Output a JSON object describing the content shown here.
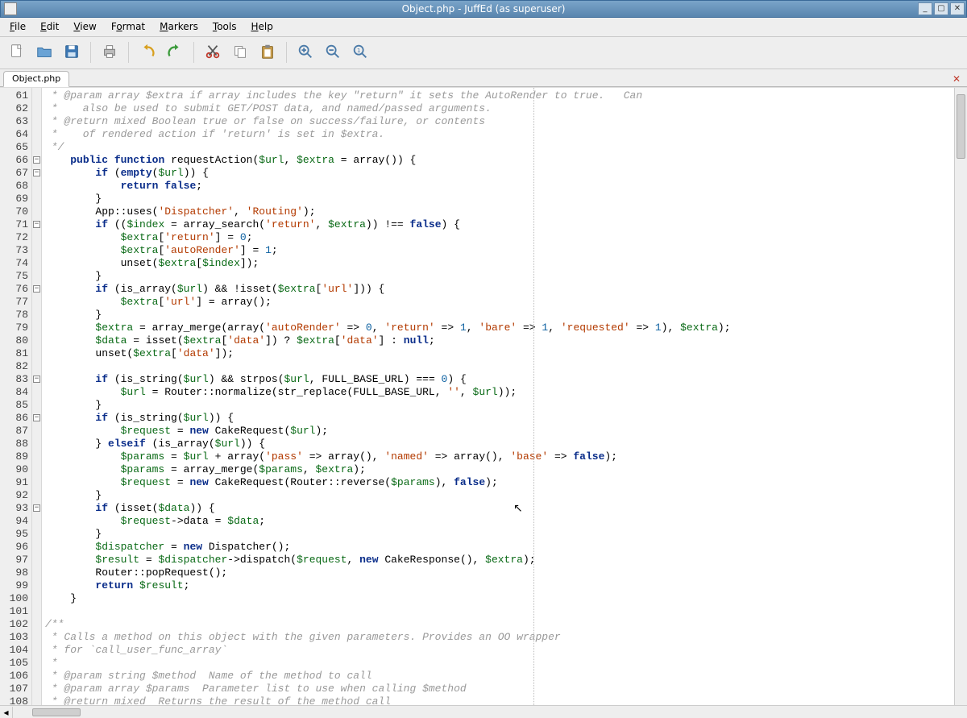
{
  "window": {
    "title": "Object.php - JuffEd (as superuser)"
  },
  "menubar": {
    "items": [
      {
        "label": "File",
        "accel": "F"
      },
      {
        "label": "Edit",
        "accel": "E"
      },
      {
        "label": "View",
        "accel": "V"
      },
      {
        "label": "Format",
        "accel": "o"
      },
      {
        "label": "Markers",
        "accel": "M"
      },
      {
        "label": "Tools",
        "accel": "T"
      },
      {
        "label": "Help",
        "accel": "H"
      }
    ]
  },
  "toolbar": {
    "buttons": [
      "new-file",
      "open-file",
      "save-file",
      "sep",
      "print",
      "sep",
      "undo",
      "redo",
      "sep",
      "cut",
      "copy",
      "paste",
      "sep",
      "zoom-in",
      "zoom-out",
      "zoom-reset"
    ]
  },
  "tabs": {
    "items": [
      {
        "label": "Object.php"
      }
    ]
  },
  "editor": {
    "first_line": 61,
    "fold_lines": [
      66,
      67,
      71,
      76,
      83,
      86,
      93
    ],
    "lines": [
      {
        "n": 61,
        "seg": [
          {
            "c": "c-comment",
            "t": " * @param array $extra if array includes the key \"return\" it sets the AutoRender to true.   Can"
          }
        ]
      },
      {
        "n": 62,
        "seg": [
          {
            "c": "c-comment",
            "t": " *    also be used to submit GET/POST data, and named/passed arguments."
          }
        ]
      },
      {
        "n": 63,
        "seg": [
          {
            "c": "c-comment",
            "t": " * @return mixed Boolean true or false on success/failure, or contents"
          }
        ]
      },
      {
        "n": 64,
        "seg": [
          {
            "c": "c-comment",
            "t": " *    of rendered action if 'return' is set in $extra."
          }
        ]
      },
      {
        "n": 65,
        "seg": [
          {
            "c": "c-comment",
            "t": " */"
          }
        ]
      },
      {
        "n": 66,
        "seg": [
          {
            "t": "    "
          },
          {
            "c": "c-kw",
            "t": "public"
          },
          {
            "t": " "
          },
          {
            "c": "c-kw",
            "t": "function"
          },
          {
            "t": " requestAction("
          },
          {
            "c": "c-var",
            "t": "$url"
          },
          {
            "t": ", "
          },
          {
            "c": "c-var",
            "t": "$extra"
          },
          {
            "t": " = array()) {"
          }
        ]
      },
      {
        "n": 67,
        "seg": [
          {
            "t": "        "
          },
          {
            "c": "c-kw",
            "t": "if"
          },
          {
            "t": " ("
          },
          {
            "c": "c-kw",
            "t": "empty"
          },
          {
            "t": "("
          },
          {
            "c": "c-var",
            "t": "$url"
          },
          {
            "t": ")) {"
          }
        ]
      },
      {
        "n": 68,
        "seg": [
          {
            "t": "            "
          },
          {
            "c": "c-kw",
            "t": "return"
          },
          {
            "t": " "
          },
          {
            "c": "c-kw",
            "t": "false"
          },
          {
            "t": ";"
          }
        ]
      },
      {
        "n": 69,
        "seg": [
          {
            "t": "        }"
          }
        ]
      },
      {
        "n": 70,
        "seg": [
          {
            "t": "        App::uses("
          },
          {
            "c": "c-str",
            "t": "'Dispatcher'"
          },
          {
            "t": ", "
          },
          {
            "c": "c-str",
            "t": "'Routing'"
          },
          {
            "t": ");"
          }
        ]
      },
      {
        "n": 71,
        "seg": [
          {
            "t": "        "
          },
          {
            "c": "c-kw",
            "t": "if"
          },
          {
            "t": " (("
          },
          {
            "c": "c-var",
            "t": "$index"
          },
          {
            "t": " = array_search("
          },
          {
            "c": "c-str",
            "t": "'return'"
          },
          {
            "t": ", "
          },
          {
            "c": "c-var",
            "t": "$extra"
          },
          {
            "t": ")) !== "
          },
          {
            "c": "c-kw",
            "t": "false"
          },
          {
            "t": ") {"
          }
        ]
      },
      {
        "n": 72,
        "seg": [
          {
            "t": "            "
          },
          {
            "c": "c-var",
            "t": "$extra"
          },
          {
            "t": "["
          },
          {
            "c": "c-str",
            "t": "'return'"
          },
          {
            "t": "] = "
          },
          {
            "c": "c-num",
            "t": "0"
          },
          {
            "t": ";"
          }
        ]
      },
      {
        "n": 73,
        "seg": [
          {
            "t": "            "
          },
          {
            "c": "c-var",
            "t": "$extra"
          },
          {
            "t": "["
          },
          {
            "c": "c-str",
            "t": "'autoRender'"
          },
          {
            "t": "] = "
          },
          {
            "c": "c-num",
            "t": "1"
          },
          {
            "t": ";"
          }
        ]
      },
      {
        "n": 74,
        "seg": [
          {
            "t": "            unset("
          },
          {
            "c": "c-var",
            "t": "$extra"
          },
          {
            "t": "["
          },
          {
            "c": "c-var",
            "t": "$index"
          },
          {
            "t": "]);"
          }
        ]
      },
      {
        "n": 75,
        "seg": [
          {
            "t": "        }"
          }
        ]
      },
      {
        "n": 76,
        "seg": [
          {
            "t": "        "
          },
          {
            "c": "c-kw",
            "t": "if"
          },
          {
            "t": " (is_array("
          },
          {
            "c": "c-var",
            "t": "$url"
          },
          {
            "t": ") && !isset("
          },
          {
            "c": "c-var",
            "t": "$extra"
          },
          {
            "t": "["
          },
          {
            "c": "c-str",
            "t": "'url'"
          },
          {
            "t": "])) {"
          }
        ]
      },
      {
        "n": 77,
        "seg": [
          {
            "t": "            "
          },
          {
            "c": "c-var",
            "t": "$extra"
          },
          {
            "t": "["
          },
          {
            "c": "c-str",
            "t": "'url'"
          },
          {
            "t": "] = array();"
          }
        ]
      },
      {
        "n": 78,
        "seg": [
          {
            "t": "        }"
          }
        ]
      },
      {
        "n": 79,
        "seg": [
          {
            "t": "        "
          },
          {
            "c": "c-var",
            "t": "$extra"
          },
          {
            "t": " = array_merge(array("
          },
          {
            "c": "c-str",
            "t": "'autoRender'"
          },
          {
            "t": " => "
          },
          {
            "c": "c-num",
            "t": "0"
          },
          {
            "t": ", "
          },
          {
            "c": "c-str",
            "t": "'return'"
          },
          {
            "t": " => "
          },
          {
            "c": "c-num",
            "t": "1"
          },
          {
            "t": ", "
          },
          {
            "c": "c-str",
            "t": "'bare'"
          },
          {
            "t": " => "
          },
          {
            "c": "c-num",
            "t": "1"
          },
          {
            "t": ", "
          },
          {
            "c": "c-str",
            "t": "'requested'"
          },
          {
            "t": " => "
          },
          {
            "c": "c-num",
            "t": "1"
          },
          {
            "t": "), "
          },
          {
            "c": "c-var",
            "t": "$extra"
          },
          {
            "t": ");"
          }
        ]
      },
      {
        "n": 80,
        "seg": [
          {
            "t": "        "
          },
          {
            "c": "c-var",
            "t": "$data"
          },
          {
            "t": " = isset("
          },
          {
            "c": "c-var",
            "t": "$extra"
          },
          {
            "t": "["
          },
          {
            "c": "c-str",
            "t": "'data'"
          },
          {
            "t": "]) ? "
          },
          {
            "c": "c-var",
            "t": "$extra"
          },
          {
            "t": "["
          },
          {
            "c": "c-str",
            "t": "'data'"
          },
          {
            "t": "] : "
          },
          {
            "c": "c-kw",
            "t": "null"
          },
          {
            "t": ";"
          }
        ]
      },
      {
        "n": 81,
        "seg": [
          {
            "t": "        unset("
          },
          {
            "c": "c-var",
            "t": "$extra"
          },
          {
            "t": "["
          },
          {
            "c": "c-str",
            "t": "'data'"
          },
          {
            "t": "]);"
          }
        ]
      },
      {
        "n": 82,
        "seg": [
          {
            "t": ""
          }
        ]
      },
      {
        "n": 83,
        "seg": [
          {
            "t": "        "
          },
          {
            "c": "c-kw",
            "t": "if"
          },
          {
            "t": " (is_string("
          },
          {
            "c": "c-var",
            "t": "$url"
          },
          {
            "t": ") && strpos("
          },
          {
            "c": "c-var",
            "t": "$url"
          },
          {
            "t": ", FULL_BASE_URL) === "
          },
          {
            "c": "c-num",
            "t": "0"
          },
          {
            "t": ") {"
          }
        ]
      },
      {
        "n": 84,
        "seg": [
          {
            "t": "            "
          },
          {
            "c": "c-var",
            "t": "$url"
          },
          {
            "t": " = Router::normalize(str_replace(FULL_BASE_URL, "
          },
          {
            "c": "c-str",
            "t": "''"
          },
          {
            "t": ", "
          },
          {
            "c": "c-var",
            "t": "$url"
          },
          {
            "t": "));"
          }
        ]
      },
      {
        "n": 85,
        "seg": [
          {
            "t": "        }"
          }
        ]
      },
      {
        "n": 86,
        "seg": [
          {
            "t": "        "
          },
          {
            "c": "c-kw",
            "t": "if"
          },
          {
            "t": " (is_string("
          },
          {
            "c": "c-var",
            "t": "$url"
          },
          {
            "t": ")) {"
          }
        ]
      },
      {
        "n": 87,
        "seg": [
          {
            "t": "            "
          },
          {
            "c": "c-var",
            "t": "$request"
          },
          {
            "t": " = "
          },
          {
            "c": "c-kw",
            "t": "new"
          },
          {
            "t": " CakeRequest("
          },
          {
            "c": "c-var",
            "t": "$url"
          },
          {
            "t": ");"
          }
        ]
      },
      {
        "n": 88,
        "seg": [
          {
            "t": "        } "
          },
          {
            "c": "c-kw",
            "t": "elseif"
          },
          {
            "t": " (is_array("
          },
          {
            "c": "c-var",
            "t": "$url"
          },
          {
            "t": ")) {"
          }
        ]
      },
      {
        "n": 89,
        "seg": [
          {
            "t": "            "
          },
          {
            "c": "c-var",
            "t": "$params"
          },
          {
            "t": " = "
          },
          {
            "c": "c-var",
            "t": "$url"
          },
          {
            "t": " + array("
          },
          {
            "c": "c-str",
            "t": "'pass'"
          },
          {
            "t": " => array(), "
          },
          {
            "c": "c-str",
            "t": "'named'"
          },
          {
            "t": " => array(), "
          },
          {
            "c": "c-str",
            "t": "'base'"
          },
          {
            "t": " => "
          },
          {
            "c": "c-kw",
            "t": "false"
          },
          {
            "t": ");"
          }
        ]
      },
      {
        "n": 90,
        "seg": [
          {
            "t": "            "
          },
          {
            "c": "c-var",
            "t": "$params"
          },
          {
            "t": " = array_merge("
          },
          {
            "c": "c-var",
            "t": "$params"
          },
          {
            "t": ", "
          },
          {
            "c": "c-var",
            "t": "$extra"
          },
          {
            "t": ");"
          }
        ]
      },
      {
        "n": 91,
        "seg": [
          {
            "t": "            "
          },
          {
            "c": "c-var",
            "t": "$request"
          },
          {
            "t": " = "
          },
          {
            "c": "c-kw",
            "t": "new"
          },
          {
            "t": " CakeRequest(Router::reverse("
          },
          {
            "c": "c-var",
            "t": "$params"
          },
          {
            "t": "), "
          },
          {
            "c": "c-kw",
            "t": "false"
          },
          {
            "t": ");"
          }
        ]
      },
      {
        "n": 92,
        "seg": [
          {
            "t": "        }"
          }
        ]
      },
      {
        "n": 93,
        "seg": [
          {
            "t": "        "
          },
          {
            "c": "c-kw",
            "t": "if"
          },
          {
            "t": " (isset("
          },
          {
            "c": "c-var",
            "t": "$data"
          },
          {
            "t": ")) {"
          }
        ]
      },
      {
        "n": 94,
        "seg": [
          {
            "t": "            "
          },
          {
            "c": "c-var",
            "t": "$request"
          },
          {
            "t": "->data = "
          },
          {
            "c": "c-var",
            "t": "$data"
          },
          {
            "t": ";"
          }
        ]
      },
      {
        "n": 95,
        "seg": [
          {
            "t": "        }"
          }
        ]
      },
      {
        "n": 96,
        "seg": [
          {
            "t": "        "
          },
          {
            "c": "c-var",
            "t": "$dispatcher"
          },
          {
            "t": " = "
          },
          {
            "c": "c-kw",
            "t": "new"
          },
          {
            "t": " Dispatcher();"
          }
        ]
      },
      {
        "n": 97,
        "seg": [
          {
            "t": "        "
          },
          {
            "c": "c-var",
            "t": "$result"
          },
          {
            "t": " = "
          },
          {
            "c": "c-var",
            "t": "$dispatcher"
          },
          {
            "t": "->dispatch("
          },
          {
            "c": "c-var",
            "t": "$request"
          },
          {
            "t": ", "
          },
          {
            "c": "c-kw",
            "t": "new"
          },
          {
            "t": " CakeResponse(), "
          },
          {
            "c": "c-var",
            "t": "$extra"
          },
          {
            "t": ");"
          }
        ]
      },
      {
        "n": 98,
        "seg": [
          {
            "t": "        Router::popRequest();"
          }
        ]
      },
      {
        "n": 99,
        "seg": [
          {
            "t": "        "
          },
          {
            "c": "c-kw",
            "t": "return"
          },
          {
            "t": " "
          },
          {
            "c": "c-var",
            "t": "$result"
          },
          {
            "t": ";"
          }
        ]
      },
      {
        "n": 100,
        "seg": [
          {
            "t": "    }"
          }
        ]
      },
      {
        "n": 101,
        "seg": [
          {
            "t": ""
          }
        ]
      },
      {
        "n": 102,
        "seg": [
          {
            "c": "c-comment",
            "t": "/**"
          }
        ]
      },
      {
        "n": 103,
        "seg": [
          {
            "c": "c-comment",
            "t": " * Calls a method on this object with the given parameters. Provides an OO wrapper"
          }
        ]
      },
      {
        "n": 104,
        "seg": [
          {
            "c": "c-comment",
            "t": " * for `call_user_func_array`"
          }
        ]
      },
      {
        "n": 105,
        "seg": [
          {
            "c": "c-comment",
            "t": " *"
          }
        ]
      },
      {
        "n": 106,
        "seg": [
          {
            "c": "c-comment",
            "t": " * @param string $method  Name of the method to call"
          }
        ]
      },
      {
        "n": 107,
        "seg": [
          {
            "c": "c-comment",
            "t": " * @param array $params  Parameter list to use when calling $method"
          }
        ]
      },
      {
        "n": 108,
        "seg": [
          {
            "c": "c-comment",
            "t": " * @return mixed  Returns the result of the method call"
          }
        ]
      }
    ]
  }
}
